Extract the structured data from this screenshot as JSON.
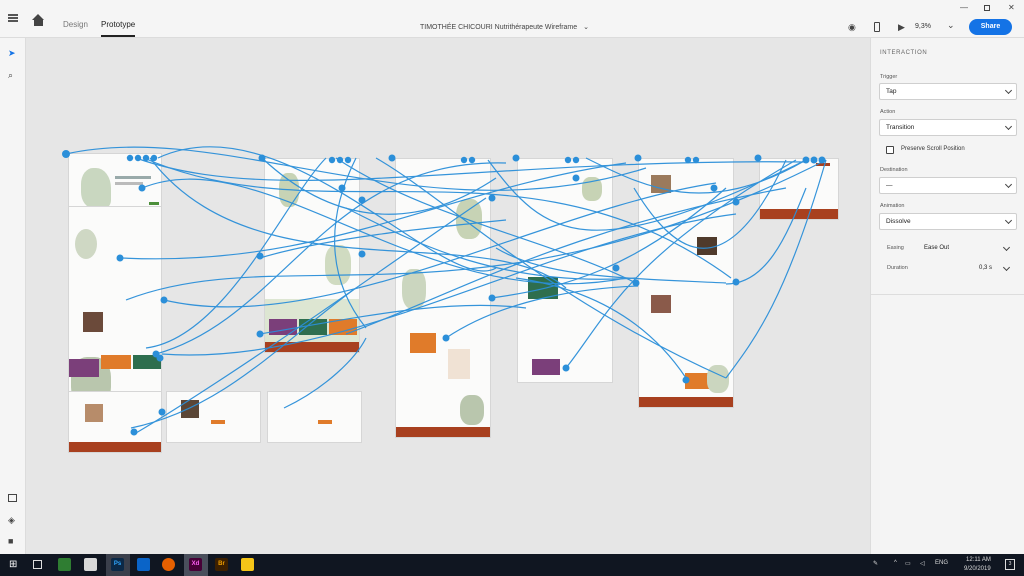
{
  "header": {
    "tabs": [
      {
        "label": "Design",
        "active": false
      },
      {
        "label": "Prototype",
        "active": true
      }
    ],
    "document_title": "TIMOTHÉE CHICOURI Nutrithérapeute Wireframe",
    "zoom": "9,3%",
    "share_label": "Share"
  },
  "panel": {
    "heading": "INTERACTION",
    "trigger": {
      "label": "Trigger",
      "value": "Tap"
    },
    "action": {
      "label": "Action",
      "value": "Transition"
    },
    "preserve_scroll_label": "Preserve Scroll Position",
    "destination": {
      "label": "Destination",
      "value": "—"
    },
    "animation": {
      "label": "Animation",
      "value": "Dissolve"
    },
    "easing": {
      "label": "Easing",
      "value": "Ease Out"
    },
    "duration": {
      "label": "Duration",
      "value": "0,3 s"
    }
  },
  "taskbar": {
    "apps": [
      "Ps",
      "Xd",
      "Br"
    ],
    "lang": "ENG",
    "time": "12:11 AM",
    "date": "9/20/2019"
  },
  "colors": {
    "wire": "#2b8fd9",
    "footer": "#a8401f",
    "accent": "#1473e6",
    "orange": "#e07b2a",
    "purple": "#7b3f7a"
  },
  "icons": [
    "menu-icon",
    "home-icon",
    "select-arrow-icon",
    "search-icon",
    "user-help-icon",
    "device-preview-icon",
    "play-icon",
    "assets-icon",
    "layers-icon",
    "plugins-icon"
  ]
}
